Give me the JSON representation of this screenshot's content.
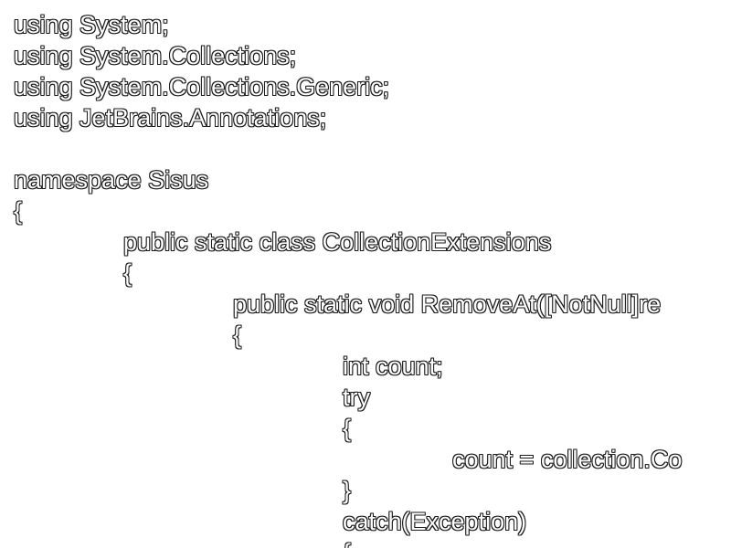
{
  "editor": {
    "lines": [
      "using System;",
      "using System.Collections;",
      "using System.Collections.Generic;",
      "using JetBrains.Annotations;",
      "",
      "namespace Sisus",
      "{",
      "public static class CollectionExtensions",
      "{",
      "public static void RemoveAt([NotNull]re",
      "{",
      "int count;",
      "try",
      "{",
      "count = collection.Co",
      "}",
      "catch(Exception)",
      "{"
    ]
  }
}
